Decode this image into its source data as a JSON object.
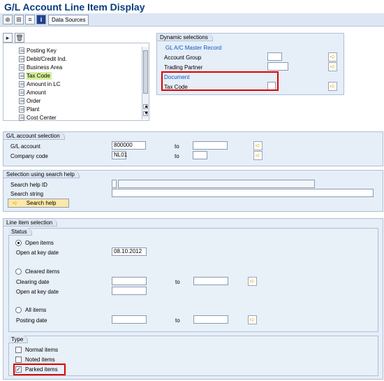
{
  "title": "G/L Account Line Item Display",
  "toolbar": {
    "data_sources_label": "Data Sources",
    "icon1": "execute-icon",
    "icon2": "save-variant-icon",
    "icon3": "document-icon",
    "icon4": "info-icon"
  },
  "dynamic_selections": {
    "tab_label": "Dynamic selections",
    "group_title": "GL A/C Master Record",
    "account_group_label": "Account Group",
    "trading_partner_label": "Trading Partner",
    "document_label": "Document",
    "tax_code_label": "Tax Code",
    "account_group_value": "",
    "trading_partner_value": "",
    "tax_code_value": ""
  },
  "tree": {
    "items": [
      "Posting Key",
      "Debit/Credit Ind.",
      "Business Area",
      "Tax Code",
      "Amount in LC",
      "Amount",
      "Order",
      "Plant",
      "Cost Center"
    ]
  },
  "gl_selection": {
    "tab_label": "G/L account selection",
    "gl_account_label": "G/L account",
    "gl_account_value": "800000",
    "company_code_label": "Company code",
    "company_code_value": "NL01",
    "to_label": "to"
  },
  "search_help": {
    "tab_label": "Selection using search help",
    "search_help_id_label": "Search help ID",
    "search_string_label": "Search string",
    "button_label": "Search help"
  },
  "line_item": {
    "tab_label": "Line item selection",
    "status_label": "Status",
    "open_items_label": "Open items",
    "open_at_key_date_label": "Open at key date",
    "open_at_key_date_value": "08.10.2012",
    "cleared_items_label": "Cleared items",
    "clearing_date_label": "Clearing date",
    "all_items_label": "All items",
    "posting_date_label": "Posting date",
    "to_label": "to",
    "type_label": "Type",
    "normal_items_label": "Normal items",
    "noted_items_label": "Noted items",
    "parked_items_label": "Parked items"
  },
  "colors": {
    "title": "#0a3c7c",
    "panel_bg": "#e6eef8",
    "highlight_red": "#e00000",
    "selected_item": "#d7ef9c"
  }
}
